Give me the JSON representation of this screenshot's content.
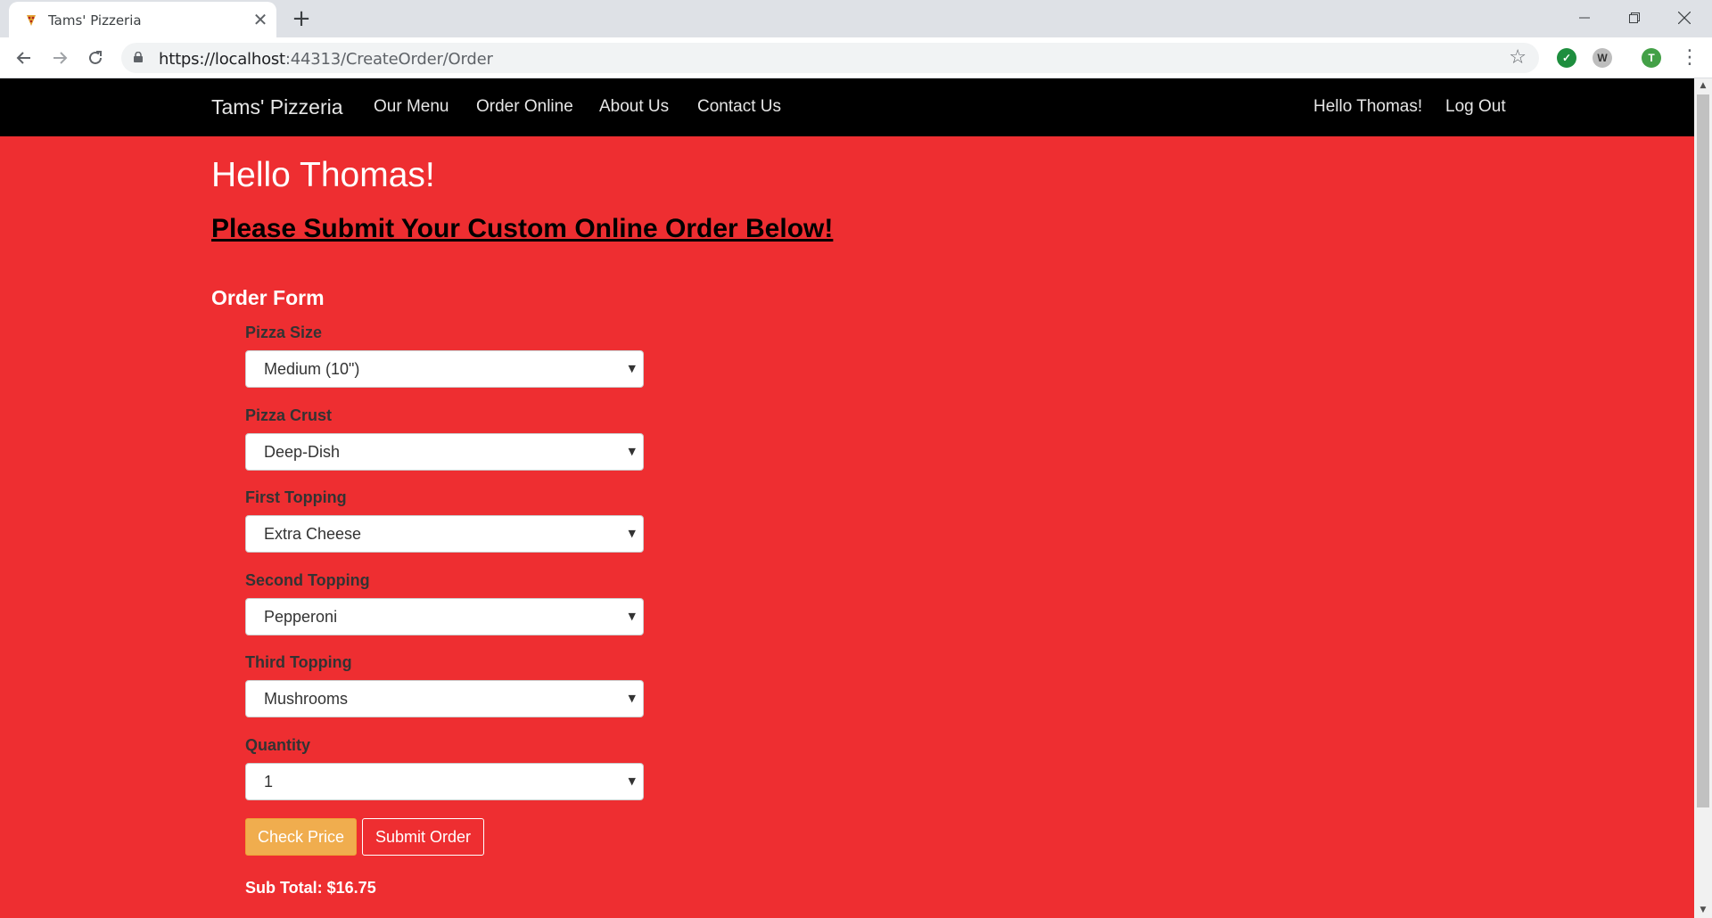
{
  "browser": {
    "tab_title": "Tams' Pizzeria",
    "tab_close": "✕",
    "new_tab": "+",
    "url_host": "https://localhost",
    "url_rest": ":44313/CreateOrder/Order",
    "profile_initial": "T",
    "ext_w": "W"
  },
  "nav": {
    "brand": "Tams' Pizzeria",
    "links": [
      "Our Menu",
      "Order Online",
      "About Us",
      "Contact Us"
    ],
    "greeting": "Hello Thomas!",
    "logout": "Log Out"
  },
  "main": {
    "hello": "Hello Thomas!",
    "subhead": "Please Submit Your Custom Online Order Below!",
    "form_title": "Order Form"
  },
  "form": {
    "fields": [
      {
        "label": "Pizza Size",
        "value": "Medium (10\")"
      },
      {
        "label": "Pizza Crust",
        "value": "Deep-Dish"
      },
      {
        "label": "First Topping",
        "value": "Extra Cheese"
      },
      {
        "label": "Second Topping",
        "value": "Pepperoni"
      },
      {
        "label": "Third Topping",
        "value": "Mushrooms"
      },
      {
        "label": "Quantity",
        "value": "1"
      }
    ],
    "check_price": "Check Price",
    "submit_order": "Submit Order",
    "subtotal": "Sub Total: $16.75"
  },
  "colors": {
    "page_bg": "#ee2e31",
    "navbar_bg": "#000000",
    "check_price_bg": "#f0ad4e"
  },
  "icons": [
    "pizza-favicon-icon",
    "close-icon",
    "plus-icon",
    "back-arrow-icon",
    "forward-arrow-icon",
    "reload-icon",
    "lock-icon",
    "star-icon",
    "check-extension-icon",
    "menu-dots-icon",
    "caret-down-icon"
  ]
}
